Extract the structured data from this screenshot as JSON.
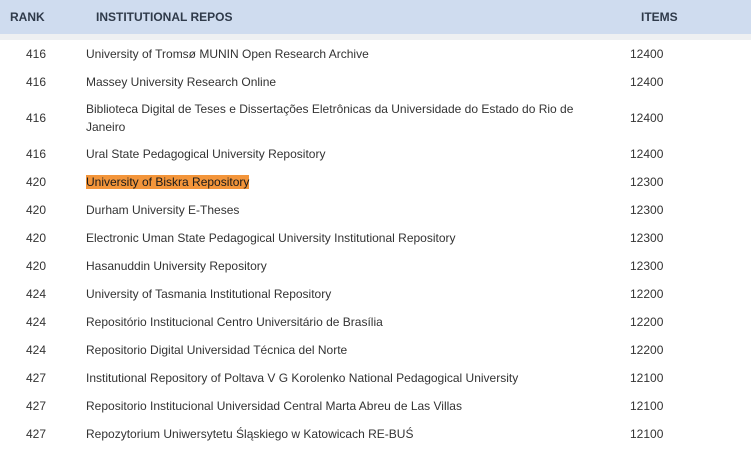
{
  "table": {
    "headers": {
      "rank": "RANK",
      "name": "INSTITUTIONAL REPOS",
      "items": "ITEMS"
    },
    "rows": [
      {
        "rank": "416",
        "name": "University of Tromsø MUNIN Open Research Archive",
        "items": "12400"
      },
      {
        "rank": "416",
        "name": "Massey University Research Online",
        "items": "12400"
      },
      {
        "rank": "416",
        "name": "Biblioteca Digital de Teses e Dissertações Eletrônicas da Universidade do Estado do Rio de Janeiro",
        "items": "12400"
      },
      {
        "rank": "416",
        "name": "Ural State Pedagogical University Repository",
        "items": "12400"
      },
      {
        "rank": "420",
        "name": "University of Biskra Repository",
        "items": "12300",
        "highlighted": true
      },
      {
        "rank": "420",
        "name": "Durham University E-Theses",
        "items": "12300"
      },
      {
        "rank": "420",
        "name": "Electronic Uman State Pedagogical University Institutional Repository",
        "items": "12300"
      },
      {
        "rank": "420",
        "name": "Hasanuddin University Repository",
        "items": "12300"
      },
      {
        "rank": "424",
        "name": "University of Tasmania Institutional Repository",
        "items": "12200"
      },
      {
        "rank": "424",
        "name": "Repositório Institucional Centro Universitário de Brasília",
        "items": "12200"
      },
      {
        "rank": "424",
        "name": "Repositorio Digital Universidad Técnica del Norte",
        "items": "12200"
      },
      {
        "rank": "427",
        "name": "Institutional Repository of Poltava V G Korolenko National Pedagogical University",
        "items": "12100"
      },
      {
        "rank": "427",
        "name": "Repositorio Institucional Universidad Central Marta Abreu de Las Villas",
        "items": "12100"
      },
      {
        "rank": "427",
        "name": "Repozytorium Uniwersytetu Śląskiego w Katowicach RE-BUŚ",
        "items": "12100"
      }
    ],
    "highlight_color": "#f3953a",
    "header_bg": "#cfdcef"
  }
}
